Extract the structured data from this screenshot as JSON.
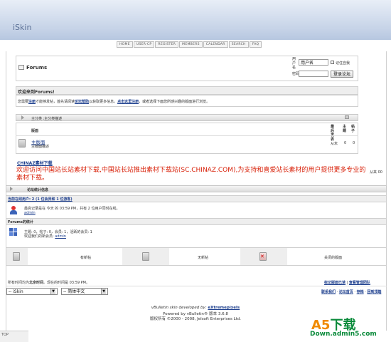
{
  "logo": {
    "text": "iSkin"
  },
  "nav": [
    "HOME",
    "USER-CP",
    "REGISTER",
    "MEMBERS",
    "CALENDAR",
    "SEARCH",
    "FAQ"
  ],
  "forum_title": "Forums",
  "login": {
    "user_label": "用户名",
    "pass_label": "密码",
    "user_value": "用户名",
    "remember_label": "记住自我",
    "submit_label": "登录论坛"
  },
  "welcome": {
    "heading": "欢迎来到Forums!",
    "text_a": "您需要",
    "register_link": "注册",
    "text_b": "才能够发帖，首先请阅读",
    "faq_link": "论坛帮助",
    "text_c": "以获取更多信息。",
    "register_here": "点击这里注册",
    "text_d": "，或者选择下面您所感兴趣的版面进行浏览。"
  },
  "category": {
    "title": "主分类 :主分类描述"
  },
  "forum_table": {
    "headers": {
      "forum": "版面",
      "last_post": "最后发表",
      "threads": "主题",
      "posts": "帖子"
    },
    "row": {
      "name": "主版面",
      "desc": "主版面描述",
      "last_post": "从未",
      "threads": "0",
      "posts": "0"
    }
  },
  "ad": {
    "title": "CHINAZ素材下载",
    "body": "欢迎访问中国站长站素材下载,中国站长站推出素材下载站(SC.CHINAZ.COM),为支持和喜爱站长素材的用户提供更多专业的素材下载。",
    "right_text": "从来 00"
  },
  "stats_bar": {
    "title": "论坛统计信息"
  },
  "online": {
    "title": "当前在线用户: 2 (1 位会员和 1 位游客)",
    "record": "最高记录是在 今天 的 03:59 PM，共有 2 位用户同时在线。",
    "user": "admin"
  },
  "forum_stats": {
    "title": "Forums的统计",
    "line1": "主题: 0，帖子: 0，会员: 1，活跃的会员: 1",
    "line2_label": "欢迎我们的新会员:",
    "new_member": "admin"
  },
  "legend": {
    "new": "有新帖",
    "nonew": "无新帖",
    "closed": "关闭的版面"
  },
  "time_info": {
    "prefix": "所有时间均为",
    "zone": "北京时间",
    "suffix": "。现在的时间是",
    "time": "03:59 PM",
    "end": "。"
  },
  "bottom_links_1": {
    "mark_read": "标记版面已读",
    "view_leaders": "查看管理团队"
  },
  "bottom_links_2": {
    "contact": "联系我们",
    "home": "论坛首页",
    "archive": "存档",
    "top": "回到顶端"
  },
  "style_select": "-- iSkin",
  "lang_select": "-- 简体中文",
  "footer": {
    "line1a": "vBulletin skin developed by:",
    "line1b": "eXtremepixels",
    "line2": "Powered by vBulletin® 版本 3.6.8",
    "line3": "版权所有 ©2000 - 2008, Jelsoft Enterprises Ltd."
  },
  "watermark": {
    "a5": "A5",
    "xiazai": "下载",
    "domain": "Down.admin5.com"
  },
  "top_tab": "TOP"
}
